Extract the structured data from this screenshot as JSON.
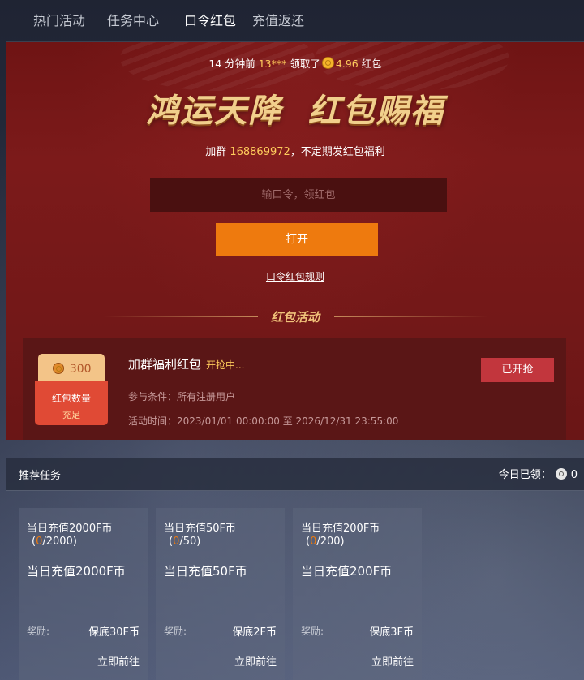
{
  "nav": {
    "tabs": [
      {
        "label": "热门活动"
      },
      {
        "label": "任务中心"
      },
      {
        "label": "口令红包"
      },
      {
        "label": "充值返还"
      }
    ],
    "active_index": 2
  },
  "notice": {
    "time": "14 分钟前",
    "user": "13***",
    "action": "领取了",
    "amount": "4.96",
    "suffix": "红包"
  },
  "banner_title": "鸿运天降  红包赐福",
  "join": {
    "prefix": "加群",
    "group": "168869972",
    "suffix": "，不定期发红包福利"
  },
  "command_input": {
    "placeholder": "输口令，领红包",
    "value": ""
  },
  "open_button": "打开",
  "rules_link": "口令红包规则",
  "section_title": "红包活动",
  "event": {
    "amount": "300",
    "count_label": "红包数量",
    "count_status": "充足",
    "name": "加群福利红包",
    "status": "开抢中...",
    "condition_label": "参与条件：",
    "condition": "所有注册用户",
    "time_label": "活动时间：",
    "time_range": "2023/01/01 00:00:00 至 2026/12/31 23:55:00",
    "button": "已开抢"
  },
  "tasks": {
    "title": "推荐任务",
    "today_label": "今日已领：",
    "today_value": "0",
    "reward_label": "奖励:",
    "go_label": "立即前往",
    "items": [
      {
        "head": "当日充值2000F币",
        "progress_done": "0",
        "progress_total": "/2000)",
        "desc": "当日充值2000F币",
        "reward": "保底30F币"
      },
      {
        "head": "当日充值50F币",
        "progress_done": "0",
        "progress_total": "/50)",
        "desc": "当日充值50F币",
        "reward": "保底2F币"
      },
      {
        "head": "当日充值200F币",
        "progress_done": "0",
        "progress_total": "/200)",
        "desc": "当日充值200F币",
        "reward": "保底3F币"
      }
    ]
  },
  "colors": {
    "accent_orange": "#ee7a0e",
    "gold_text": "#ffcc5c",
    "panel_red": "#7c1a1a",
    "button_red": "#c2363d"
  }
}
